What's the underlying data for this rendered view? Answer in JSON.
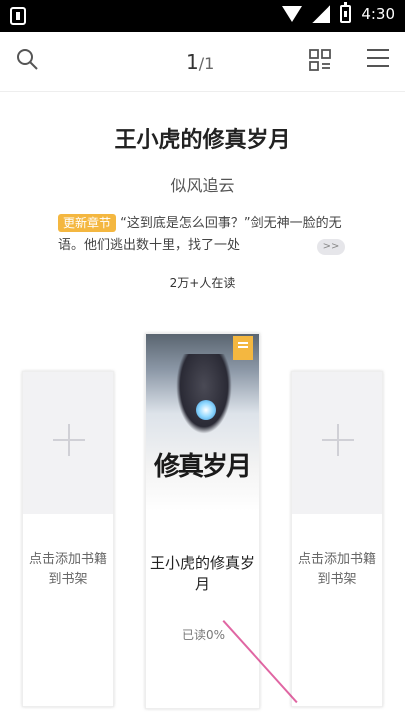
{
  "status_bar": {
    "time": "4:30"
  },
  "toolbar": {
    "current_page": "1",
    "separator": "/",
    "total_pages": "1",
    "search_icon": "search-icon",
    "scan_icon": "scan-icon",
    "menu_icon": "menu-icon"
  },
  "book": {
    "title": "王小虎的修真岁月",
    "author": "似风追云",
    "update_tag": "更新章节",
    "update_text": "“这到底是怎么回事？”剑无神一脸的无语。他们逃出数十里，找了一处",
    "more_label": ">>",
    "readers": "2万+人在读"
  },
  "shelf": {
    "add_left": "点击添加书籍到书架",
    "add_right": "点击添加书籍到书架",
    "center_name": "王小虎的修真岁月",
    "center_progress": "已读0%",
    "cover_calligraphy": "修真岁月"
  },
  "colors": {
    "accent": "#f4b740",
    "background": "#ffffff"
  }
}
